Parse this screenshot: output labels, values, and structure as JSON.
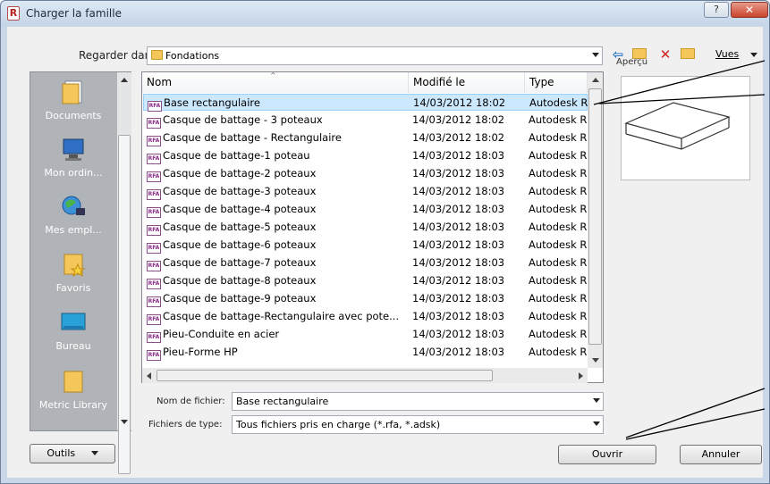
{
  "window": {
    "title": "Charger la famille"
  },
  "titlebar": {
    "help_label": "?",
    "close_label": "✕"
  },
  "lookin": {
    "label": "Regarder dans:",
    "value": "Fondations"
  },
  "toolbar": {
    "views_label": "Vues"
  },
  "places": [
    {
      "label": "Documents",
      "icon": "documents-icon"
    },
    {
      "label": "Mon ordin...",
      "icon": "computer-icon"
    },
    {
      "label": "Mes empl...",
      "icon": "network-places-icon"
    },
    {
      "label": "Favoris",
      "icon": "favorites-icon"
    },
    {
      "label": "Bureau",
      "icon": "desktop-icon"
    },
    {
      "label": "Metric Library",
      "icon": "folder-icon"
    }
  ],
  "filelist": {
    "columns": [
      "Nom",
      "Modifié le",
      "Type"
    ],
    "rows": [
      {
        "name": "Base rectangulaire",
        "modified": "14/03/2012 18:02",
        "type": "Autodesk R"
      },
      {
        "name": "Casque de battage - 3 poteaux",
        "modified": "14/03/2012 18:02",
        "type": "Autodesk R"
      },
      {
        "name": "Casque de battage - Rectangulaire",
        "modified": "14/03/2012 18:02",
        "type": "Autodesk R"
      },
      {
        "name": "Casque de battage-1 poteau",
        "modified": "14/03/2012 18:03",
        "type": "Autodesk R"
      },
      {
        "name": "Casque de battage-2 poteaux",
        "modified": "14/03/2012 18:03",
        "type": "Autodesk R"
      },
      {
        "name": "Casque de battage-3 poteaux",
        "modified": "14/03/2012 18:03",
        "type": "Autodesk R"
      },
      {
        "name": "Casque de battage-4 poteaux",
        "modified": "14/03/2012 18:03",
        "type": "Autodesk R"
      },
      {
        "name": "Casque de battage-5 poteaux",
        "modified": "14/03/2012 18:03",
        "type": "Autodesk R"
      },
      {
        "name": "Casque de battage-6 poteaux",
        "modified": "14/03/2012 18:03",
        "type": "Autodesk R"
      },
      {
        "name": "Casque de battage-7 poteaux",
        "modified": "14/03/2012 18:03",
        "type": "Autodesk R"
      },
      {
        "name": "Casque de battage-8 poteaux",
        "modified": "14/03/2012 18:03",
        "type": "Autodesk R"
      },
      {
        "name": "Casque de battage-9 poteaux",
        "modified": "14/03/2012 18:03",
        "type": "Autodesk R"
      },
      {
        "name": "Casque de battage-Rectangulaire avec pote...",
        "modified": "14/03/2012 18:03",
        "type": "Autodesk R"
      },
      {
        "name": "Pieu-Conduite en acier",
        "modified": "14/03/2012 18:03",
        "type": "Autodesk R"
      },
      {
        "name": "Pieu-Forme HP",
        "modified": "14/03/2012 18:03",
        "type": "Autodesk R"
      }
    ],
    "selected_index": 0
  },
  "preview": {
    "label": "Aperçu"
  },
  "filename": {
    "label": "Nom de fichier:",
    "value": "Base rectangulaire"
  },
  "filetype": {
    "label": "Fichiers de type:",
    "value": "Tous fichiers pris en charge  (*.rfa, *.adsk)"
  },
  "buttons": {
    "tools": "Outils",
    "open": "Ouvrir",
    "cancel": "Annuler"
  },
  "colors": {
    "selection": "#cce8ff",
    "places_bg": "#b0b3b7",
    "close": "#c8442c"
  }
}
